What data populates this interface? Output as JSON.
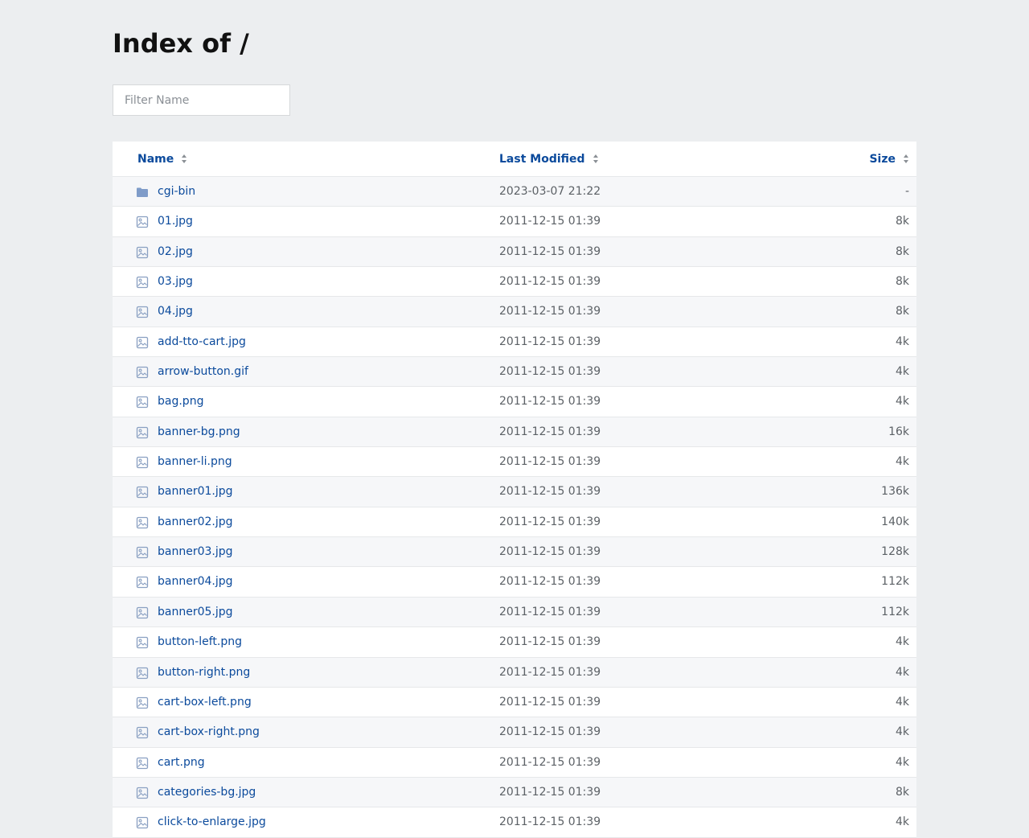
{
  "title": "Index of /",
  "filter": {
    "placeholder": "Filter Name"
  },
  "columns": {
    "name": "Name",
    "modified": "Last Modified",
    "size": "Size"
  },
  "colors": {
    "link": "#0b4a9c",
    "icon": "#8aa0c2",
    "folder": "#7f9cc9"
  },
  "rows": [
    {
      "type": "folder",
      "name": "cgi-bin",
      "modified": "2023-03-07 21:22",
      "size": "-"
    },
    {
      "type": "image",
      "name": "01.jpg",
      "modified": "2011-12-15 01:39",
      "size": "8k"
    },
    {
      "type": "image",
      "name": "02.jpg",
      "modified": "2011-12-15 01:39",
      "size": "8k"
    },
    {
      "type": "image",
      "name": "03.jpg",
      "modified": "2011-12-15 01:39",
      "size": "8k"
    },
    {
      "type": "image",
      "name": "04.jpg",
      "modified": "2011-12-15 01:39",
      "size": "8k"
    },
    {
      "type": "image",
      "name": "add-tto-cart.jpg",
      "modified": "2011-12-15 01:39",
      "size": "4k"
    },
    {
      "type": "image",
      "name": "arrow-button.gif",
      "modified": "2011-12-15 01:39",
      "size": "4k"
    },
    {
      "type": "image",
      "name": "bag.png",
      "modified": "2011-12-15 01:39",
      "size": "4k"
    },
    {
      "type": "image",
      "name": "banner-bg.png",
      "modified": "2011-12-15 01:39",
      "size": "16k"
    },
    {
      "type": "image",
      "name": "banner-li.png",
      "modified": "2011-12-15 01:39",
      "size": "4k"
    },
    {
      "type": "image",
      "name": "banner01.jpg",
      "modified": "2011-12-15 01:39",
      "size": "136k"
    },
    {
      "type": "image",
      "name": "banner02.jpg",
      "modified": "2011-12-15 01:39",
      "size": "140k"
    },
    {
      "type": "image",
      "name": "banner03.jpg",
      "modified": "2011-12-15 01:39",
      "size": "128k"
    },
    {
      "type": "image",
      "name": "banner04.jpg",
      "modified": "2011-12-15 01:39",
      "size": "112k"
    },
    {
      "type": "image",
      "name": "banner05.jpg",
      "modified": "2011-12-15 01:39",
      "size": "112k"
    },
    {
      "type": "image",
      "name": "button-left.png",
      "modified": "2011-12-15 01:39",
      "size": "4k"
    },
    {
      "type": "image",
      "name": "button-right.png",
      "modified": "2011-12-15 01:39",
      "size": "4k"
    },
    {
      "type": "image",
      "name": "cart-box-left.png",
      "modified": "2011-12-15 01:39",
      "size": "4k"
    },
    {
      "type": "image",
      "name": "cart-box-right.png",
      "modified": "2011-12-15 01:39",
      "size": "4k"
    },
    {
      "type": "image",
      "name": "cart.png",
      "modified": "2011-12-15 01:39",
      "size": "4k"
    },
    {
      "type": "image",
      "name": "categories-bg.jpg",
      "modified": "2011-12-15 01:39",
      "size": "8k"
    },
    {
      "type": "image",
      "name": "click-to-enlarge.jpg",
      "modified": "2011-12-15 01:39",
      "size": "4k"
    }
  ]
}
